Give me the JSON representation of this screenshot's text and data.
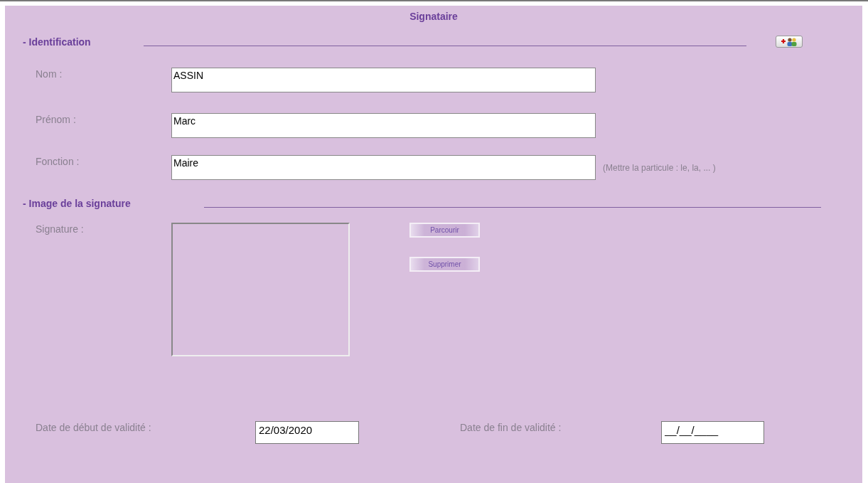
{
  "title": "Signataire",
  "identification": {
    "heading": "- Identification",
    "fields": [
      {
        "label": "Nom :",
        "value": "ASSIN"
      },
      {
        "label": "Prénom :",
        "value": "Marc"
      },
      {
        "label": "Fonction :",
        "value": "Maire",
        "hint": "(Mettre la particule : le, la, ... )"
      }
    ]
  },
  "signature_section": {
    "heading": "- Image de la signature",
    "label": "Signature :",
    "buttons": [
      "Parcourir",
      "Supprimer"
    ]
  },
  "dates": [
    {
      "label": "Date de début de validité :",
      "value": "22/03/2020"
    },
    {
      "label": "Date de fin de validité :",
      "value": "__/__/____"
    }
  ]
}
